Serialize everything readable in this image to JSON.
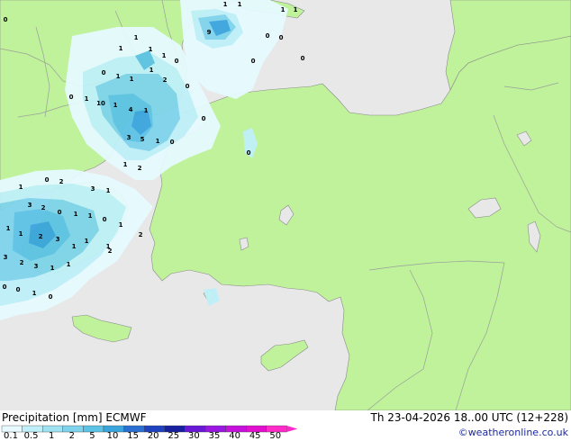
{
  "header": {
    "title": "Precipitation [mm]",
    "model": "ECMWF",
    "datetime": "Th 23-04-2026 18..00 UTC (12+228)",
    "credit": "©weatheronline.co.uk"
  },
  "legend": {
    "ticks": [
      "0.1",
      "0.5",
      "1",
      "2",
      "5",
      "10",
      "15",
      "20",
      "25",
      "30",
      "35",
      "40",
      "45",
      "50"
    ],
    "colors": [
      "#e6faff",
      "#bff0f9",
      "#9fe2f2",
      "#7fd3ec",
      "#5cc3e6",
      "#3aa5dd",
      "#2a6fd1",
      "#1f42c0",
      "#17209e",
      "#6a18d8",
      "#9a16e2",
      "#c611dc",
      "#e20fcf",
      "#ff2ac8"
    ]
  },
  "map": {
    "colors": {
      "sea": "#e8e8e8",
      "land": "#bff29a",
      "border": "#9aa09a",
      "coast": "#8a8a8a"
    },
    "values": [
      "0",
      "1",
      "1",
      "1",
      "1",
      "9",
      "0",
      "0",
      "1",
      "1",
      "1",
      "1",
      "0",
      "0",
      "0",
      "0",
      "1",
      "1",
      "1",
      "2",
      "10",
      "1",
      "4",
      "1",
      "0",
      "1",
      "3",
      "5",
      "1",
      "0",
      "1",
      "2",
      "0",
      "0",
      "2",
      "0",
      "3",
      "1",
      "1",
      "3",
      "2",
      "0",
      "1",
      "1",
      "0",
      "1",
      "2",
      "3",
      "1",
      "1",
      "2",
      "3",
      "1",
      "1",
      "3",
      "1",
      "1",
      "1",
      "2",
      "2",
      "0",
      "0",
      "1",
      "0",
      "0"
    ]
  }
}
